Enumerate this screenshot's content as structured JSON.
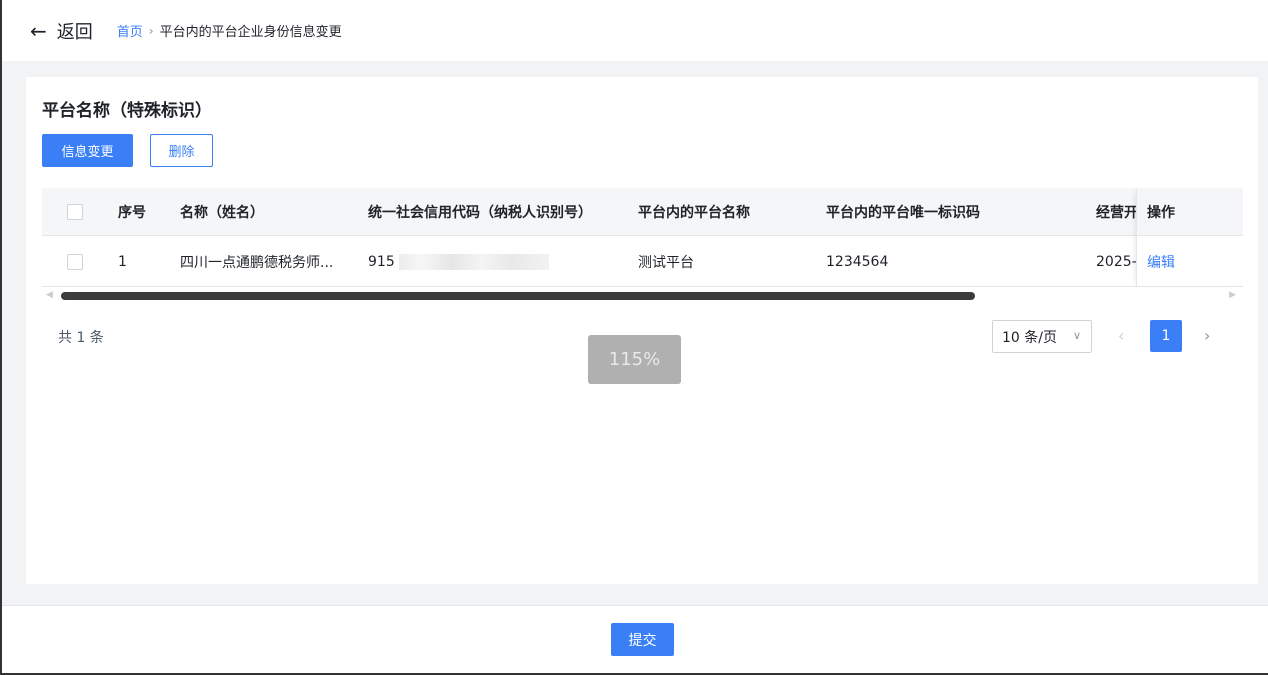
{
  "header": {
    "back_icon": "arrow-left-icon",
    "back_label": "返回",
    "breadcrumb": {
      "home": "首页",
      "separator": "›",
      "current": "平台内的平台企业身份信息变更"
    }
  },
  "card": {
    "title": "平台名称（特殊标识）",
    "actions": {
      "change_label": "信息变更",
      "delete_label": "删除"
    }
  },
  "table": {
    "columns": [
      "序号",
      "名称（姓名）",
      "统一社会信用代码（纳税人识别号）",
      "平台内的平台名称",
      "平台内的平台唯一标识码",
      "经营开",
      "操作"
    ],
    "rows": [
      {
        "index": "1",
        "name": "四川一点通鹏德税务师...",
        "credit_code": "915",
        "platform_name": "测试平台",
        "platform_id": "1234564",
        "start_date": "2025-",
        "action": "编辑"
      }
    ],
    "scroll_progress": 0.77
  },
  "pagination": {
    "total": "共 1 条",
    "page_size": "10 条/页",
    "current_page": "1"
  },
  "zoom_indicator": "115%",
  "footer": {
    "submit_label": "提交"
  },
  "colors": {
    "accent": "#3a7ff6",
    "header_bg": "#f5f6f8",
    "page_bg": "#f2f3f5"
  }
}
